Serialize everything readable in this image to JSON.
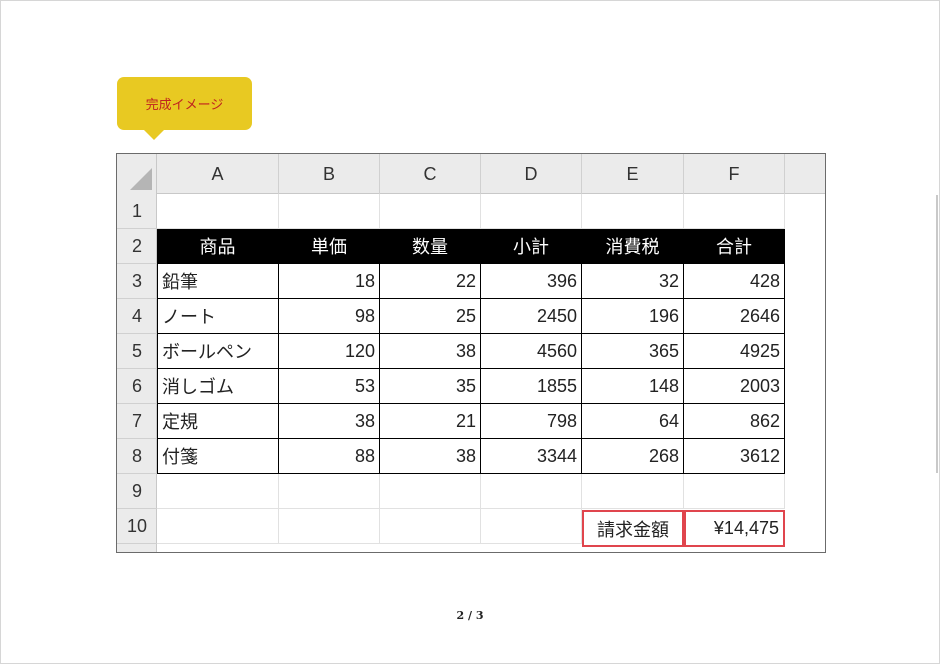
{
  "callout": {
    "label": "完成イメージ"
  },
  "sheet": {
    "columns": [
      "A",
      "B",
      "C",
      "D",
      "E",
      "F"
    ],
    "rows": [
      "1",
      "2",
      "3",
      "4",
      "5",
      "6",
      "7",
      "8",
      "9",
      "10"
    ],
    "header": [
      "商品",
      "単価",
      "数量",
      "小計",
      "消費税",
      "合計"
    ],
    "data": [
      [
        "鉛筆",
        "18",
        "22",
        "396",
        "32",
        "428"
      ],
      [
        "ノート",
        "98",
        "25",
        "2450",
        "196",
        "2646"
      ],
      [
        "ボールペン",
        "120",
        "38",
        "4560",
        "365",
        "4925"
      ],
      [
        "消しゴム",
        "53",
        "35",
        "1855",
        "148",
        "2003"
      ],
      [
        "定規",
        "38",
        "21",
        "798",
        "64",
        "862"
      ],
      [
        "付箋",
        "88",
        "38",
        "3344",
        "268",
        "3612"
      ]
    ],
    "invoice_label": "請求金額",
    "invoice_value": "¥14,475"
  },
  "pager": {
    "text": "2 / 3"
  },
  "colors": {
    "callout_bg": "#e8c922",
    "callout_text": "#c0211f",
    "header_bg": "#000000",
    "highlight_border": "#e0454d"
  }
}
